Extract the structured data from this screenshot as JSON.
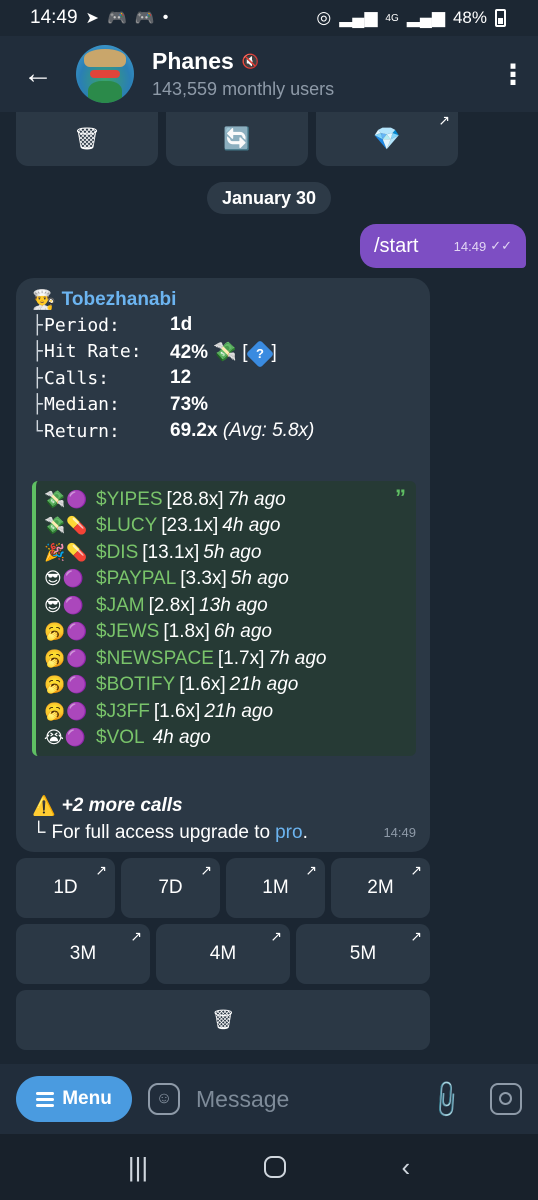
{
  "status_bar": {
    "time": "14:49",
    "battery": "48%",
    "icons_left": [
      "telegram-icon",
      "gamepad-icon",
      "gamepad-icon",
      "dot-icon"
    ],
    "icons_right": [
      "hotspot-icon",
      "signal-icon",
      "4g-icon",
      "signal-icon",
      "battery-icon"
    ]
  },
  "header": {
    "title": "Phanes",
    "subtitle": "143,559 monthly users"
  },
  "top_keyboard": [
    "🗑",
    "🔄",
    "💎"
  ],
  "date_separator": "January 30",
  "outgoing": {
    "text": "/start",
    "time": "14:49"
  },
  "message": {
    "sender_emoji": "👨‍🍳",
    "sender": "Tobezhanabi",
    "stats": [
      {
        "tree": "├",
        "key": "Period:",
        "value": "1d"
      },
      {
        "tree": "├",
        "key": "Hit Rate:",
        "value": "42%",
        "emoji": "💸",
        "extra": "[",
        "badge": "?",
        "extra_end": "]"
      },
      {
        "tree": "├",
        "key": "Calls:",
        "value": "12"
      },
      {
        "tree": "├",
        "key": "Median:",
        "value": "73%"
      },
      {
        "tree": "└",
        "key": "Return:",
        "value": "69.2x",
        "note": "(Avg: 5.8x)"
      }
    ],
    "calls": [
      {
        "emoji": "💸🟣",
        "ticker": "$YIPES",
        "mult": "[28.8x]",
        "ago": "7h ago"
      },
      {
        "emoji": "💸💊",
        "ticker": "$LUCY",
        "mult": "[23.1x]",
        "ago": "4h ago"
      },
      {
        "emoji": "🎉💊",
        "ticker": "$DIS",
        "mult": "[13.1x]",
        "ago": "5h ago"
      },
      {
        "emoji": "😎🟣",
        "ticker": "$PAYPAL",
        "mult": "[3.3x]",
        "ago": "5h ago"
      },
      {
        "emoji": "😎🟣",
        "ticker": "$JAM",
        "mult": "[2.8x]",
        "ago": "13h ago"
      },
      {
        "emoji": "🥱🟣",
        "ticker": "$JEWS",
        "mult": "[1.8x]",
        "ago": "6h ago"
      },
      {
        "emoji": "🥱🟣",
        "ticker": "$NEWSPACE",
        "mult": "[1.7x]",
        "ago": "7h ago"
      },
      {
        "emoji": "🥱🟣",
        "ticker": "$BOTIFY",
        "mult": "[1.6x]",
        "ago": "21h ago"
      },
      {
        "emoji": "🥱🟣",
        "ticker": "$J3FF",
        "mult": "[1.6x]",
        "ago": "21h ago"
      },
      {
        "emoji": "😭🟣",
        "ticker": "$VOL",
        "mult": "",
        "ago": "4h ago"
      }
    ],
    "more_calls_icon": "⚠️",
    "more_calls": "+2 more calls",
    "upgrade_tree": "└",
    "upgrade_text": "For full access upgrade to",
    "upgrade_link": "pro",
    "upgrade_end": ".",
    "time": "14:49"
  },
  "keyboard": {
    "row1": [
      "1D",
      "7D",
      "1M",
      "2M"
    ],
    "row2": [
      "3M",
      "4M",
      "5M"
    ],
    "row3": [
      "🗑"
    ]
  },
  "composer": {
    "menu_label": "Menu",
    "placeholder": "Message"
  }
}
